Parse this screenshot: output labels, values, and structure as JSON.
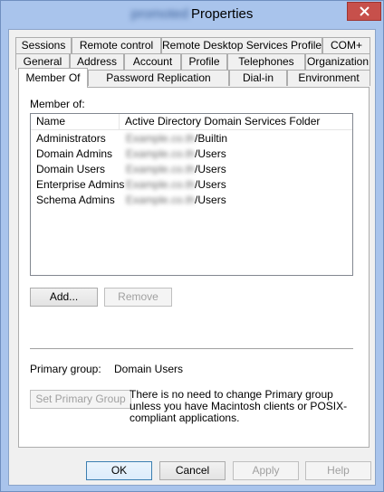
{
  "window": {
    "title_blurred": "promoted",
    "title": "Properties"
  },
  "icons": {
    "close": "close-icon"
  },
  "tabs": {
    "row1": [
      "Sessions",
      "Remote control",
      "Remote Desktop Services Profile",
      "COM+"
    ],
    "row2": [
      "General",
      "Address",
      "Account",
      "Profile",
      "Telephones",
      "Organization"
    ],
    "row3": [
      "Member Of",
      "Password Replication",
      "Dial-in",
      "Environment"
    ],
    "active": "Member Of"
  },
  "member_of": {
    "label": "Member of:",
    "columns": [
      "Name",
      "Active Directory Domain Services Folder"
    ],
    "rows": [
      {
        "name": "Administrators",
        "folder_blurred": "Example.co.th",
        "folder": "/Builtin"
      },
      {
        "name": "Domain Admins",
        "folder_blurred": "Example.co.th",
        "folder": "/Users"
      },
      {
        "name": "Domain Users",
        "folder_blurred": "Example.co.th",
        "folder": "/Users"
      },
      {
        "name": "Enterprise Admins",
        "folder_blurred": "Example.co.th",
        "folder": "/Users"
      },
      {
        "name": "Schema Admins",
        "folder_blurred": "Example.co.th",
        "folder": "/Users"
      }
    ]
  },
  "buttons": {
    "add": "Add...",
    "remove": "Remove",
    "set_primary": "Set Primary Group",
    "ok": "OK",
    "cancel": "Cancel",
    "apply": "Apply",
    "help": "Help"
  },
  "primary_group": {
    "label": "Primary group:",
    "value": "Domain Users",
    "note": "There is no need to change Primary group unless you have Macintosh clients or POSIX-compliant applications."
  }
}
